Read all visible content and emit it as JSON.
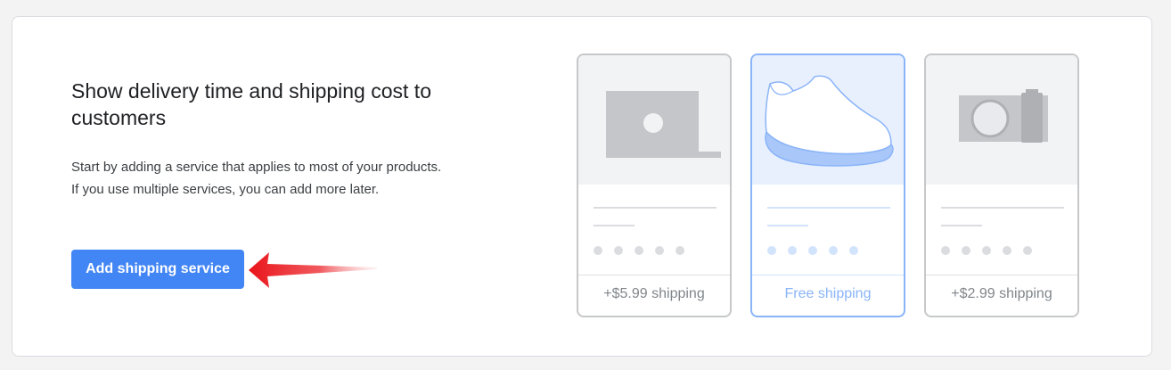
{
  "intro": {
    "title": "Show delivery time and shipping cost to customers",
    "description": "Start by adding a service that applies to most of your products. If you use multiple services, you can add more later.",
    "button_label": "Add shipping service"
  },
  "cards": [
    {
      "icon": "laptop-icon",
      "price_label": "+$5.99 shipping",
      "highlighted": false
    },
    {
      "icon": "shoe-icon",
      "price_label": "Free shipping",
      "highlighted": true
    },
    {
      "icon": "camera-icon",
      "price_label": "+$2.99 shipping",
      "highlighted": false
    }
  ],
  "colors": {
    "accent": "#4285f4",
    "highlight_border": "#8ab4f8",
    "highlight_bg": "#e8f0fe",
    "arrow": "#e8151b"
  }
}
